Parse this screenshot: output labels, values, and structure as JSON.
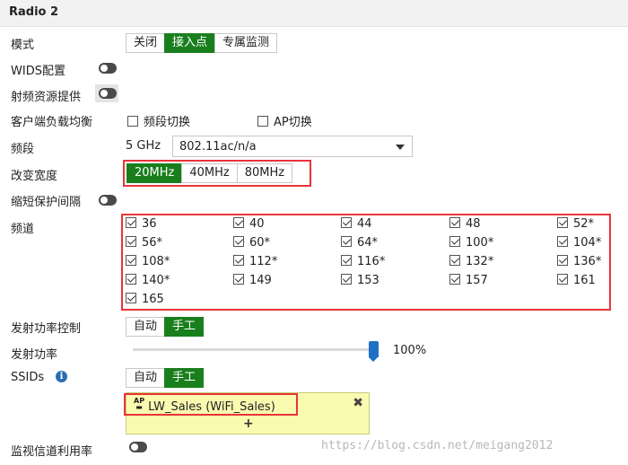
{
  "header": {
    "title": "Radio 2"
  },
  "mode": {
    "label": "模式",
    "options": [
      "关闭",
      "接入点",
      "专属监测"
    ],
    "selected": "接入点"
  },
  "wids": {
    "label": "WIDS配置",
    "enabled": false
  },
  "rf_resource": {
    "label": "射频资源提供",
    "enabled": false
  },
  "load_balance": {
    "label": "客户端负载均衡",
    "options": [
      "频段切换",
      "AP切换"
    ]
  },
  "band": {
    "label": "频段",
    "prefix": "5 GHz",
    "value": "802.11ac/n/a"
  },
  "bandwidth": {
    "label": "改变宽度",
    "options": [
      "20MHz",
      "40MHz",
      "80MHz"
    ],
    "selected": "20MHz"
  },
  "short_gi": {
    "label": "缩短保护间隔",
    "enabled": false
  },
  "channels": {
    "label": "频道",
    "items": [
      "36",
      "40",
      "44",
      "48",
      "52*",
      "56*",
      "60*",
      "64*",
      "100*",
      "104*",
      "108*",
      "112*",
      "116*",
      "132*",
      "136*",
      "140*",
      "149",
      "153",
      "157",
      "161",
      "165"
    ]
  },
  "power_control": {
    "label": "发射功率控制",
    "options": [
      "自动",
      "手工"
    ],
    "selected": "手工"
  },
  "tx_power": {
    "label": "发射功率",
    "value": "100%",
    "level": 1.0
  },
  "ssids": {
    "label": "SSIDs",
    "options": [
      "自动",
      "手工"
    ],
    "selected": "手工",
    "items": [
      "LW_Sales (WiFi_Sales)"
    ],
    "add_symbol": "+",
    "remove_symbol": "✖"
  },
  "monitor_channel": {
    "label": "监视信道利用率",
    "enabled": false
  },
  "watermark": "https://blog.csdn.net/meigang2012",
  "icons": {
    "info": "info-icon",
    "ap": "ap-icon",
    "dropdown": "caret-down-icon"
  },
  "colors": {
    "active": "#197f1d",
    "highlight_box": "#e8343a",
    "slider": "#1f6fc5",
    "ssid_bg": "#fafab0"
  }
}
